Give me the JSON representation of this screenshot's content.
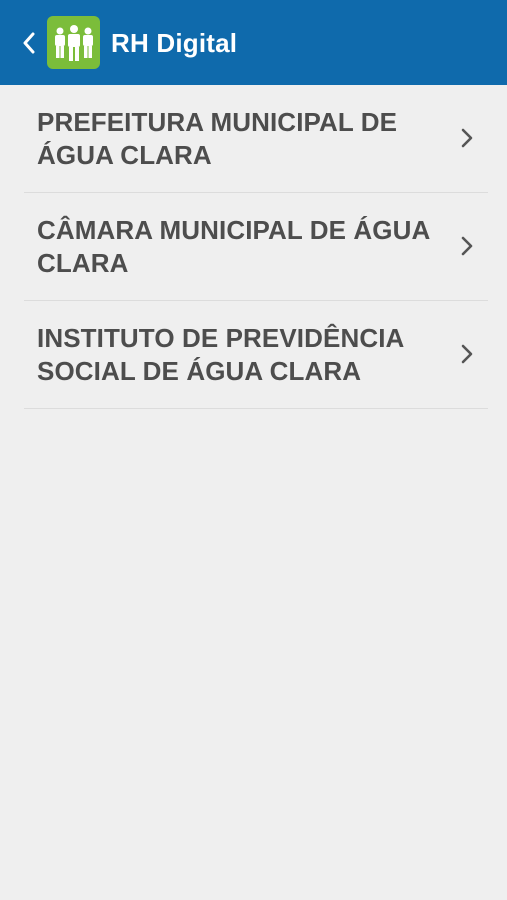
{
  "app_bar": {
    "title": "RH Digital",
    "back_icon": "chevron-left-icon",
    "logo_icon": "people-group-icon",
    "colors": {
      "bar": "#0f6aac",
      "logo_bg": "#7bbd3a"
    }
  },
  "list": {
    "items": [
      {
        "label": "PREFEITURA MUNICIPAL DE ÁGUA CLARA"
      },
      {
        "label": "CÂMARA MUNICIPAL DE ÁGUA CLARA"
      },
      {
        "label": "INSTITUTO DE PREVIDÊNCIA SOCIAL DE ÁGUA CLARA"
      }
    ],
    "item_icon": "chevron-right-icon"
  }
}
